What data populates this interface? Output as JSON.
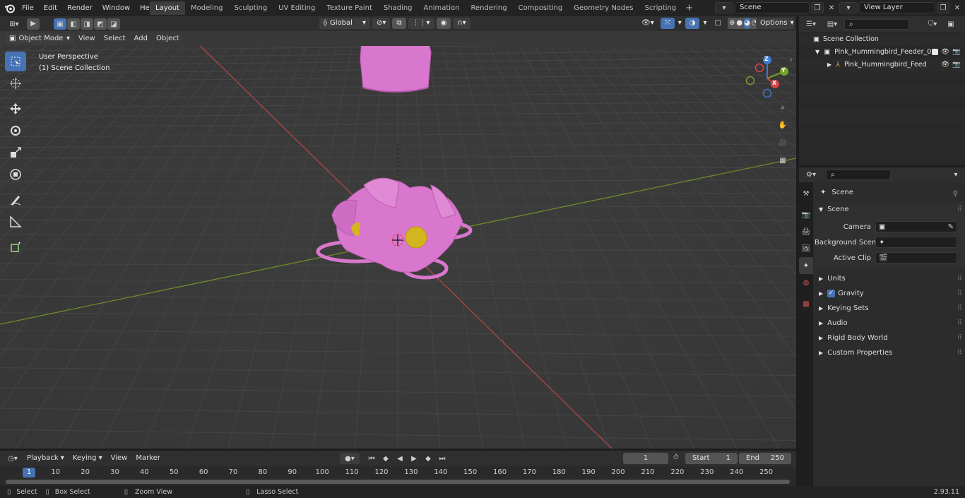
{
  "topbar": {
    "menus": [
      "File",
      "Edit",
      "Render",
      "Window",
      "Help"
    ],
    "workspaces": [
      "Layout",
      "Modeling",
      "Sculpting",
      "UV Editing",
      "Texture Paint",
      "Shading",
      "Animation",
      "Rendering",
      "Compositing",
      "Geometry Nodes",
      "Scripting"
    ],
    "active_workspace": "Layout",
    "scene_name": "Scene",
    "view_layer": "View Layer"
  },
  "viewport": {
    "mode": "Object Mode",
    "menus": [
      "View",
      "Select",
      "Add",
      "Object"
    ],
    "transform_orientation": "Global",
    "options_label": "Options",
    "overlay_line1": "User Perspective",
    "overlay_line2": "(1) Scene Collection",
    "gizmo": {
      "x": "X",
      "y": "Y",
      "z": "Z"
    }
  },
  "outliner": {
    "root": "Scene Collection",
    "items": [
      {
        "label": "Pink_Hummingbird_Feeder_0"
      },
      {
        "label": "Pink_Hummingbird_Feed"
      }
    ]
  },
  "properties": {
    "context": "Scene",
    "panel": "Scene",
    "fields": [
      {
        "label": "Camera"
      },
      {
        "label": "Background Scene"
      },
      {
        "label": "Active Clip"
      }
    ],
    "sections": [
      "Units",
      "Gravity",
      "Keying Sets",
      "Audio",
      "Rigid Body World",
      "Custom Properties"
    ]
  },
  "timeline": {
    "menus": [
      "Playback",
      "Keying",
      "View",
      "Marker"
    ],
    "current_frame": "1",
    "start_label": "Start",
    "start_value": "1",
    "end_label": "End",
    "end_value": "250",
    "ruler": [
      "1",
      "10",
      "20",
      "30",
      "40",
      "50",
      "60",
      "70",
      "80",
      "90",
      "100",
      "110",
      "120",
      "130",
      "140",
      "150",
      "160",
      "170",
      "180",
      "190",
      "200",
      "210",
      "220",
      "230",
      "240",
      "250"
    ]
  },
  "status": {
    "select": "Select",
    "box_select": "Box Select",
    "zoom_view": "Zoom View",
    "lasso_select": "Lasso Select",
    "version": "2.93.11"
  },
  "colors": {
    "accent": "#4772b3",
    "object_pink": "#d877cd",
    "x_axis": "#c84a4a",
    "y_axis": "#7ea22f"
  }
}
